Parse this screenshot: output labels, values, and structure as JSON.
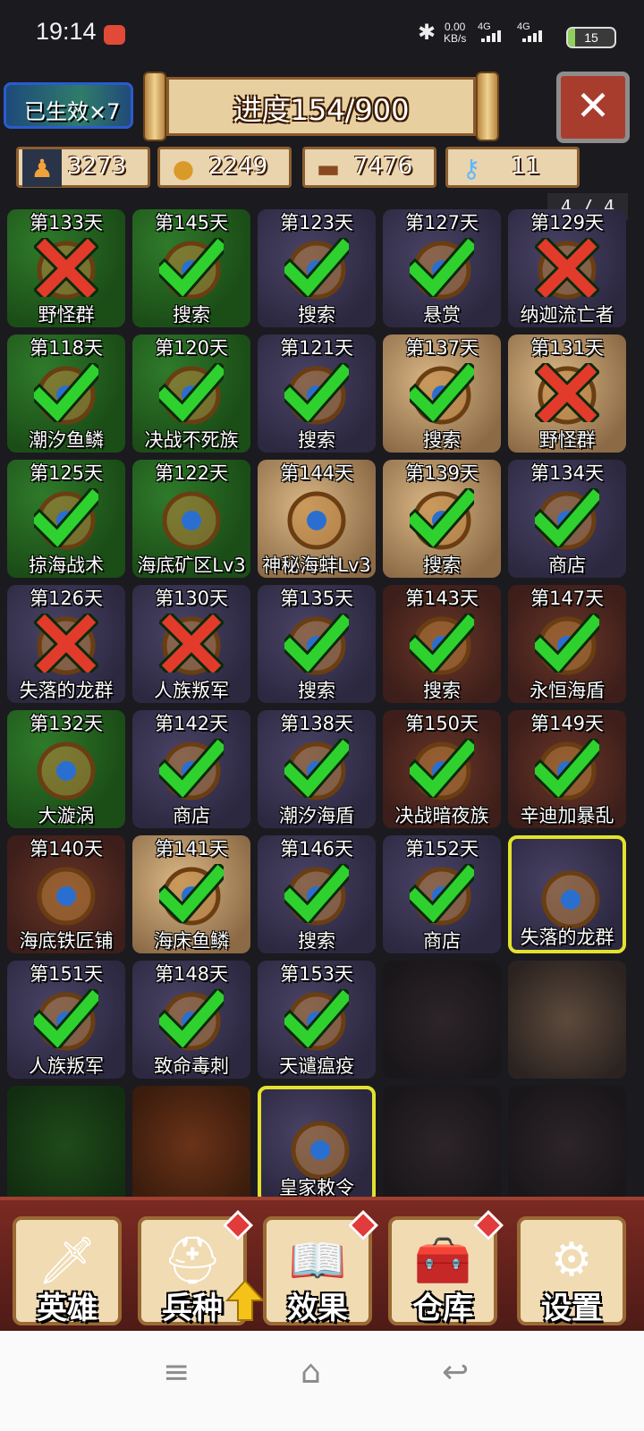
{
  "status_bar": {
    "time": "19:14",
    "speed_value": "0.00",
    "speed_unit": "KB/s",
    "network1": "4G",
    "network2": "4G",
    "battery": "15",
    "battery_level_percent": 15
  },
  "header": {
    "effect_badge": "已生效×7",
    "progress_title": "进度154/900",
    "close_label": "✕"
  },
  "resources": [
    {
      "icon": "population-icon",
      "value": "3273"
    },
    {
      "icon": "gold-coins-icon",
      "value": "2249"
    },
    {
      "icon": "wood-logs-icon",
      "value": "7476"
    },
    {
      "icon": "crystal-key-icon",
      "value": "11"
    }
  ],
  "page_indicator": "4 / 4",
  "tiles": [
    {
      "day": "第133天",
      "label": "野怪群",
      "bg": "forest",
      "mark": "cross"
    },
    {
      "day": "第145天",
      "label": "搜索",
      "bg": "forest",
      "mark": "check"
    },
    {
      "day": "第123天",
      "label": "搜索",
      "bg": "stone",
      "mark": "check"
    },
    {
      "day": "第127天",
      "label": "悬赏",
      "bg": "stone",
      "mark": "check"
    },
    {
      "day": "第129天",
      "label": "纳迦流亡者",
      "bg": "stone",
      "mark": "cross"
    },
    {
      "day": "第118天",
      "label": "潮汐鱼鳞",
      "bg": "forest",
      "mark": "check"
    },
    {
      "day": "第120天",
      "label": "决战不死族",
      "bg": "forest",
      "mark": "check"
    },
    {
      "day": "第121天",
      "label": "搜索",
      "bg": "stone",
      "mark": "check"
    },
    {
      "day": "第137天",
      "label": "搜索",
      "bg": "sand",
      "mark": "check"
    },
    {
      "day": "第131天",
      "label": "野怪群",
      "bg": "sand",
      "mark": "cross"
    },
    {
      "day": "第125天",
      "label": "掠海战术",
      "bg": "forest",
      "mark": "check"
    },
    {
      "day": "第122天",
      "label": "海底矿区Lv3",
      "bg": "forest",
      "mark": "none"
    },
    {
      "day": "第144天",
      "label": "神秘海蚌Lv3",
      "bg": "sand",
      "mark": "none"
    },
    {
      "day": "第139天",
      "label": "搜索",
      "bg": "sand",
      "mark": "check"
    },
    {
      "day": "第134天",
      "label": "商店",
      "bg": "stone",
      "mark": "check"
    },
    {
      "day": "第126天",
      "label": "失落的龙群",
      "bg": "stone",
      "mark": "cross"
    },
    {
      "day": "第130天",
      "label": "人族叛军",
      "bg": "stone",
      "mark": "cross"
    },
    {
      "day": "第135天",
      "label": "搜索",
      "bg": "stone",
      "mark": "check"
    },
    {
      "day": "第143天",
      "label": "搜索",
      "bg": "lava",
      "mark": "check"
    },
    {
      "day": "第147天",
      "label": "永恒海盾",
      "bg": "lava",
      "mark": "check"
    },
    {
      "day": "第132天",
      "label": "大漩涡",
      "bg": "forest",
      "mark": "none"
    },
    {
      "day": "第142天",
      "label": "商店",
      "bg": "stone",
      "mark": "check"
    },
    {
      "day": "第138天",
      "label": "潮汐海盾",
      "bg": "stone",
      "mark": "check"
    },
    {
      "day": "第150天",
      "label": "决战暗夜族",
      "bg": "lava",
      "mark": "check"
    },
    {
      "day": "第149天",
      "label": "辛迪加暴乱",
      "bg": "lava",
      "mark": "check"
    },
    {
      "day": "第140天",
      "label": "海底铁匠铺",
      "bg": "lava",
      "mark": "none"
    },
    {
      "day": "第141天",
      "label": "海床鱼鳞",
      "bg": "sand",
      "mark": "check"
    },
    {
      "day": "第146天",
      "label": "搜索",
      "bg": "stone",
      "mark": "check"
    },
    {
      "day": "第152天",
      "label": "商店",
      "bg": "stone",
      "mark": "check"
    },
    {
      "day": "",
      "label": "失落的龙群",
      "bg": "stone",
      "mark": "none",
      "selected": true
    },
    {
      "day": "第151天",
      "label": "人族叛军",
      "bg": "stone",
      "mark": "check"
    },
    {
      "day": "第148天",
      "label": "致命毒刺",
      "bg": "stone",
      "mark": "check"
    },
    {
      "day": "第153天",
      "label": "天谴瘟疫",
      "bg": "stone",
      "mark": "check"
    },
    {
      "day": "",
      "label": "",
      "bg": "darkcrack",
      "mark": "none"
    },
    {
      "day": "",
      "label": "",
      "bg": "cobble",
      "mark": "none"
    },
    {
      "day": "",
      "label": "",
      "bg": "darkgreen",
      "mark": "none"
    },
    {
      "day": "",
      "label": "",
      "bg": "brown",
      "mark": "none"
    },
    {
      "day": "",
      "label": "皇家敕令",
      "bg": "stone",
      "mark": "none",
      "selected": true
    },
    {
      "day": "",
      "label": "",
      "bg": "darkcrack",
      "mark": "none"
    },
    {
      "day": "",
      "label": "",
      "bg": "darkcrack",
      "mark": "none"
    }
  ],
  "bottom_nav": [
    {
      "label": "英雄",
      "icon": "sword-icon",
      "glyph": "🗡",
      "alert": false
    },
    {
      "label": "兵种",
      "icon": "knight-helmet-icon",
      "glyph": "⛑",
      "alert": true
    },
    {
      "label": "效果",
      "icon": "spellbook-icon",
      "glyph": "📖",
      "alert": true
    },
    {
      "label": "仓库",
      "icon": "treasure-chest-icon",
      "glyph": "🧰",
      "alert": true
    },
    {
      "label": "设置",
      "icon": "gear-icon",
      "glyph": "⚙",
      "alert": false
    }
  ],
  "system_nav": {
    "menu": "≡",
    "home": "⌂",
    "back": "↩"
  },
  "colors": {
    "check_green": "#2fd12f",
    "cross_red": "#e23b2b",
    "selected_border": "#e2e22e"
  }
}
